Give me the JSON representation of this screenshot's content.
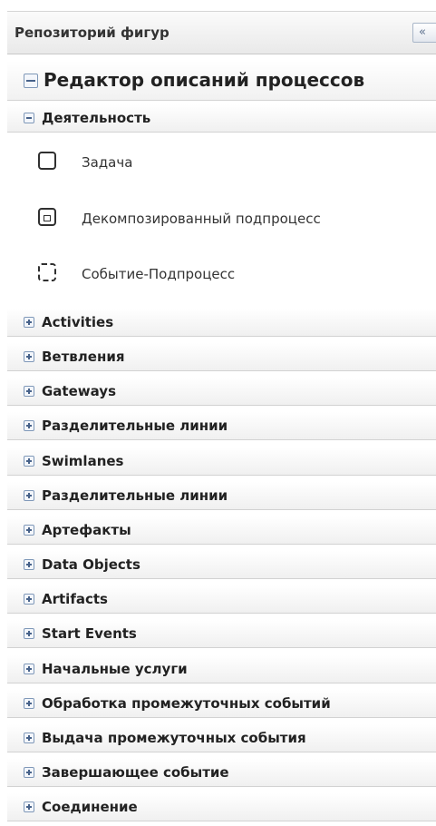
{
  "repository": {
    "title": "Репозиторий фигур",
    "collapse_label": "«"
  },
  "editor": {
    "title": "Редактор описаний процессов"
  },
  "activity_group": {
    "label": "Деятельность",
    "expanded": true,
    "items": [
      {
        "label": "Задача",
        "icon": "task-shape-icon"
      },
      {
        "label": "Декомпозированный подпроцесс",
        "icon": "collapsed-subprocess-icon"
      },
      {
        "label": "Событие-Подпроцесс",
        "icon": "event-subprocess-icon"
      }
    ]
  },
  "groups": [
    {
      "label": "Activities"
    },
    {
      "label": "Ветвления"
    },
    {
      "label": "Gateways"
    },
    {
      "label": "Разделительные линии"
    },
    {
      "label": "Swimlanes"
    },
    {
      "label": "Разделительные линии"
    },
    {
      "label": "Артефакты"
    },
    {
      "label": "Data Objects"
    },
    {
      "label": "Artifacts"
    },
    {
      "label": "Start Events"
    },
    {
      "label": "Начальные услуги"
    },
    {
      "label": "Обработка промежуточных событий"
    },
    {
      "label": "Выдача промежуточных события"
    },
    {
      "label": "Завершающее событие"
    },
    {
      "label": "Соединение"
    }
  ]
}
